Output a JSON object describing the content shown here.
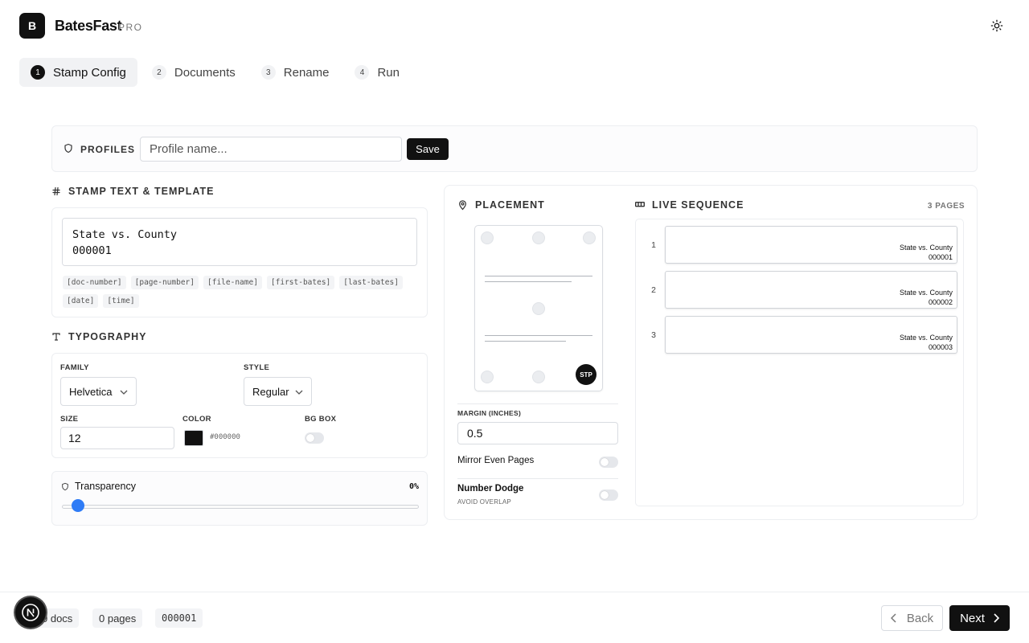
{
  "app": {
    "logo_letter": "B",
    "name": "BatesFast",
    "tier": "PRO"
  },
  "steps": [
    {
      "num": "1",
      "label": "Stamp Config"
    },
    {
      "num": "2",
      "label": "Documents"
    },
    {
      "num": "3",
      "label": "Rename"
    },
    {
      "num": "4",
      "label": "Run"
    }
  ],
  "profiles": {
    "label": "PROFILES",
    "placeholder": "Profile name...",
    "save_label": "Save"
  },
  "stamp": {
    "heading": "STAMP TEXT & TEMPLATE",
    "template": "State vs. County\n000001",
    "tokens": [
      "[doc-number]",
      "[page-number]",
      "[file-name]",
      "[first-bates]",
      "[last-bates]",
      "[date]",
      "[time]"
    ]
  },
  "typography": {
    "heading": "TYPOGRAPHY",
    "family_label": "FAMILY",
    "family_value": "Helvetica",
    "style_label": "STYLE",
    "style_value": "Regular",
    "size_label": "SIZE",
    "size_value": "12",
    "color_label": "COLOR",
    "color_value": "#000000",
    "bgbox_label": "BG BOX"
  },
  "transparency": {
    "label": "Transparency",
    "value_text": "0%",
    "value": 0
  },
  "placement": {
    "heading": "PLACEMENT",
    "badge": "STP",
    "margin_label": "MARGIN (INCHES)",
    "margin_value": "0.5",
    "mirror_label": "Mirror Even Pages",
    "dodge_label": "Number Dodge",
    "dodge_sub": "AVOID OVERLAP"
  },
  "sequence": {
    "heading": "LIVE SEQUENCE",
    "count": "3 PAGES",
    "pages": [
      {
        "num": "1",
        "line1": "State vs. County",
        "line2": "000001"
      },
      {
        "num": "2",
        "line1": "State vs. County",
        "line2": "000002"
      },
      {
        "num": "3",
        "line1": "State vs. County",
        "line2": "000003"
      }
    ]
  },
  "footer": {
    "docs": "0 docs",
    "pages": "0 pages",
    "bates": "000001",
    "back_label": "Back",
    "next_label": "Next"
  },
  "colors": {
    "accent": "#2f7cf6",
    "primary": "#111111",
    "swatch": "#111111"
  }
}
